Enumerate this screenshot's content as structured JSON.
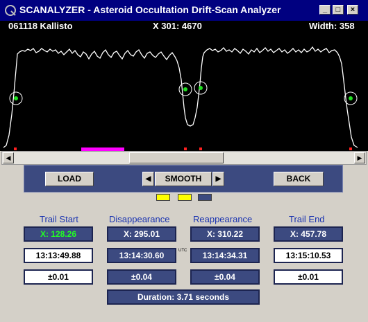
{
  "window": {
    "title": "SCANALYZER - Asteroid Occultation Drift-Scan Analyzer",
    "minimize_glyph": "_",
    "maximize_glyph": "□",
    "close_glyph": "×"
  },
  "plot": {
    "event_label": "061118 Kallisto",
    "cursor_readout": "X 301: 4670",
    "width_readout": "Width: 358"
  },
  "toolbar": {
    "load": "LOAD",
    "smooth": "SMOOTH",
    "prev_arrow": "◀",
    "next_arrow": "▶",
    "back": "BACK"
  },
  "scrollbar": {
    "left_arrow": "◀",
    "right_arrow": "▶"
  },
  "swatches": [
    "#ffff00",
    "#ffff00",
    "#3c4a80"
  ],
  "results": {
    "trail_start": {
      "label": "Trail Start",
      "x": "X:  128.26",
      "time": "13:13:49.88",
      "err": "±0.01"
    },
    "disappearance": {
      "label": "Disappearance",
      "x": "X:  295.01",
      "time": "13:14:30.60",
      "err": "±0.04"
    },
    "reappearance": {
      "label": "Reappearance",
      "x": "X:  310.22",
      "time": "13:14:34.31",
      "err": "±0.04"
    },
    "trail_end": {
      "label": "Trail End",
      "x": "X:  457.78",
      "time": "13:15:10.53",
      "err": "±0.01"
    },
    "utc_label": "UTC",
    "duration": "Duration:  3.71  seconds"
  }
}
